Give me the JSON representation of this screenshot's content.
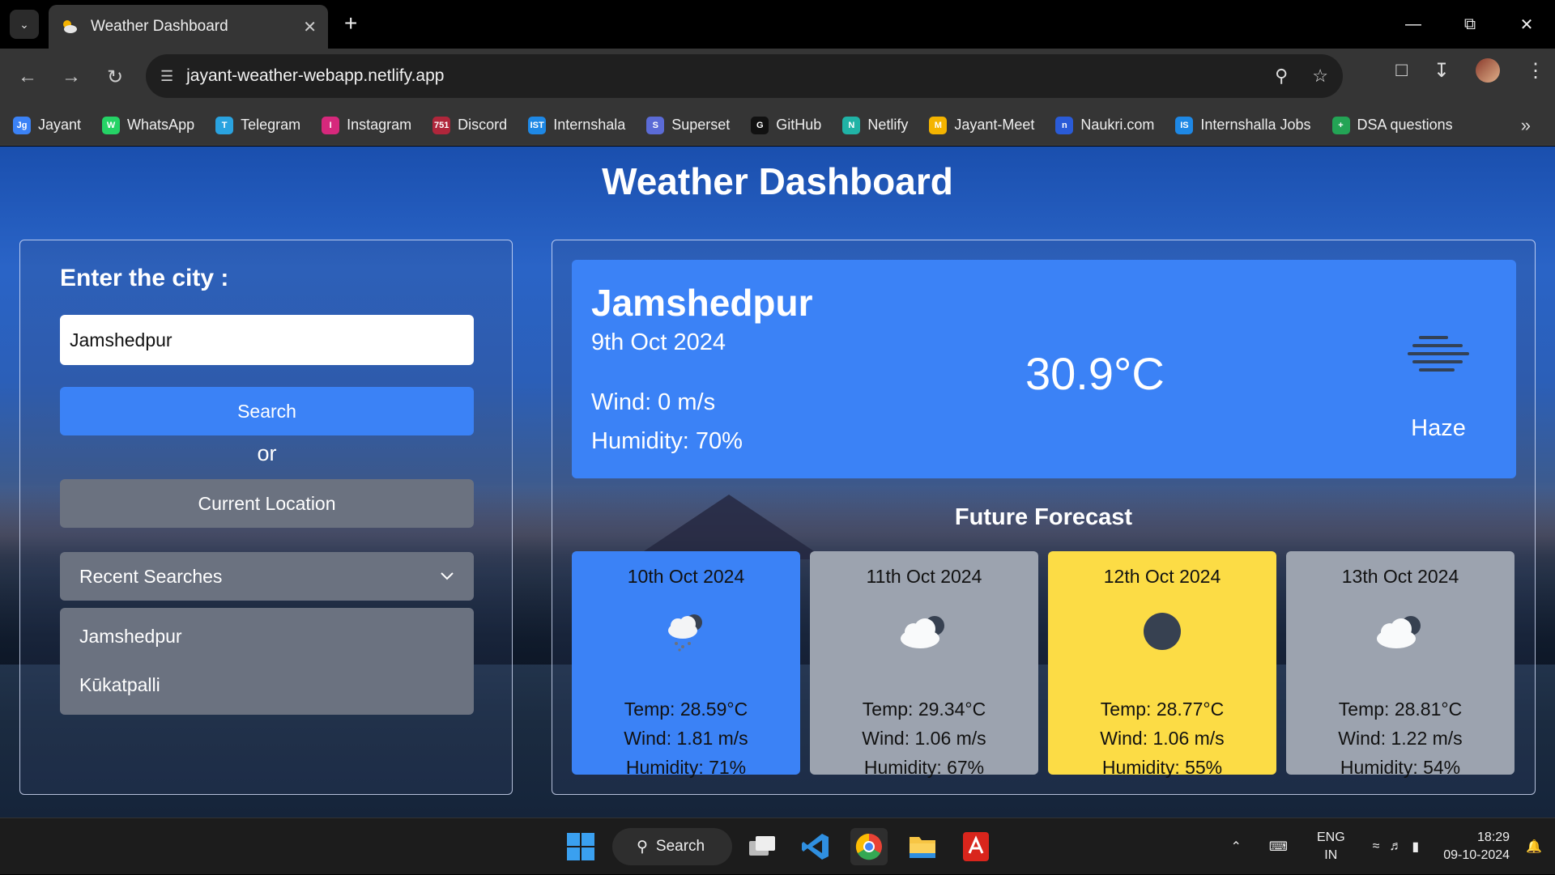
{
  "browser": {
    "tab_title": "Weather Dashboard",
    "url": "jayant-weather-webapp.netlify.app",
    "bookmarks": [
      {
        "label": "Jayant",
        "color": "#3b82f6",
        "icon": "Jg"
      },
      {
        "label": "WhatsApp",
        "color": "#25d366",
        "icon": "W"
      },
      {
        "label": "Telegram",
        "color": "#2aa3e0",
        "icon": "T"
      },
      {
        "label": "Instagram",
        "color": "#d6287c",
        "icon": "I"
      },
      {
        "label": "Discord",
        "color": "#b0263b",
        "icon": "751"
      },
      {
        "label": "Internshala",
        "color": "#1e88e5",
        "icon": "IST"
      },
      {
        "label": "Superset",
        "color": "#5b6bd6",
        "icon": "S"
      },
      {
        "label": "GitHub",
        "color": "#111111",
        "icon": "G"
      },
      {
        "label": "Netlify",
        "color": "#20b3a6",
        "icon": "N"
      },
      {
        "label": "Jayant-Meet",
        "color": "#f4b400",
        "icon": "M"
      },
      {
        "label": "Naukri.com",
        "color": "#2a5bd7",
        "icon": "n"
      },
      {
        "label": "Internshalla Jobs",
        "color": "#1e88e5",
        "icon": "IS"
      },
      {
        "label": "DSA questions",
        "color": "#23a455",
        "icon": "+"
      }
    ]
  },
  "app": {
    "title": "Weather Dashboard",
    "search_label": "Enter the city :",
    "city_value": "Jamshedpur",
    "search_button": "Search",
    "or_text": "or",
    "location_button": "Current Location",
    "recent_label": "Recent Searches",
    "recent_items": [
      "Jamshedpur",
      "Kūkatpalli"
    ]
  },
  "current": {
    "city": "Jamshedpur",
    "date": "9th Oct 2024",
    "wind": "Wind: 0 m/s",
    "humidity": "Humidity: 70%",
    "temp": "30.9°C",
    "condition": "Haze",
    "icon": "haze-icon"
  },
  "forecast": {
    "title": "Future Forecast",
    "days": [
      {
        "date": "10th Oct 2024",
        "temp": "Temp: 28.59°C",
        "wind": "Wind: 1.81 m/s",
        "humidity": "Humidity: 71%",
        "color": "#3b82f6",
        "icon": "rain-cloud-icon"
      },
      {
        "date": "11th Oct 2024",
        "temp": "Temp: 29.34°C",
        "wind": "Wind: 1.06 m/s",
        "humidity": "Humidity: 67%",
        "color": "#9ca3af",
        "icon": "cloud-icon"
      },
      {
        "date": "12th Oct 2024",
        "temp": "Temp: 28.77°C",
        "wind": "Wind: 1.06 m/s",
        "humidity": "Humidity: 55%",
        "color": "#fcdc45",
        "icon": "moon-icon"
      },
      {
        "date": "13th Oct 2024",
        "temp": "Temp: 28.81°C",
        "wind": "Wind: 1.22 m/s",
        "humidity": "Humidity: 54%",
        "color": "#9ca3af",
        "icon": "cloud-icon"
      }
    ]
  },
  "taskbar": {
    "search": "Search",
    "lang": "ENG",
    "region": "IN",
    "time": "18:29",
    "date": "09-10-2024"
  }
}
